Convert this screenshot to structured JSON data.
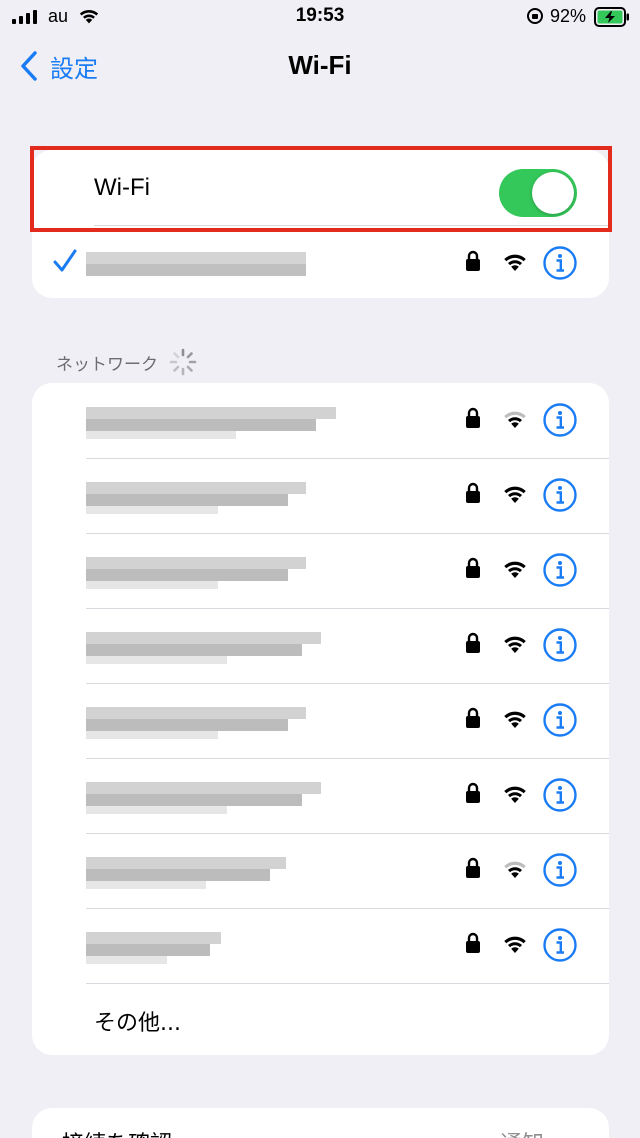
{
  "status_bar": {
    "carrier": "au",
    "time": "19:53",
    "battery_percent": "92%"
  },
  "nav": {
    "back_label": "設定",
    "title": "Wi-Fi"
  },
  "wifi_toggle": {
    "label": "Wi-Fi",
    "on": true
  },
  "connected_network": {
    "name": "",
    "secured": true,
    "icons": [
      "checkmark-icon",
      "lock-icon",
      "wifi-signal-icon",
      "info-icon"
    ]
  },
  "networks_section": {
    "header": "ネットワーク"
  },
  "networks": [
    {
      "name": "",
      "secured": true,
      "signal": "weak"
    },
    {
      "name": "",
      "secured": true,
      "signal": "full"
    },
    {
      "name": "",
      "secured": true,
      "signal": "full"
    },
    {
      "name": "",
      "secured": true,
      "signal": "full"
    },
    {
      "name": "",
      "secured": true,
      "signal": "full"
    },
    {
      "name": "",
      "secured": true,
      "signal": "full"
    },
    {
      "name": "",
      "secured": true,
      "signal": "weak"
    },
    {
      "name": "",
      "secured": true,
      "signal": "full"
    }
  ],
  "other_label": "その他...",
  "ask_to_join": {
    "label": "接続を確認",
    "value": "通知"
  },
  "colors": {
    "accent": "#1a7cf4",
    "toggle_on": "#34c759",
    "highlight": "#e22b1c",
    "background": "#f0eff5"
  }
}
